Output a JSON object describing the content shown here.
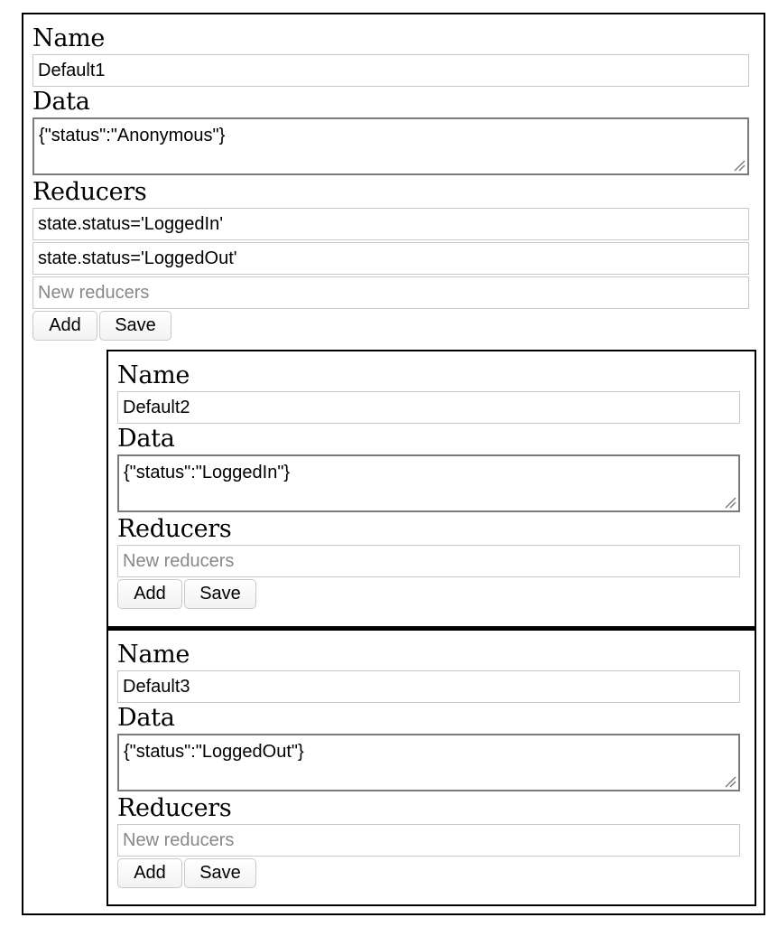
{
  "labels": {
    "name": "Name",
    "data": "Data",
    "reducers": "Reducers",
    "add": "Add",
    "save": "Save",
    "new_reducers_placeholder": "New reducers"
  },
  "stores": [
    {
      "name": "Default1",
      "data": "{\"status\":\"Anonymous\"}",
      "reducers": [
        "state.status='LoggedIn'",
        "state.status='LoggedOut'"
      ]
    },
    {
      "name": "Default2",
      "data": "{\"status\":\"LoggedIn\"}",
      "reducers": []
    },
    {
      "name": "Default3",
      "data": "{\"status\":\"LoggedOut\"}",
      "reducers": []
    }
  ]
}
